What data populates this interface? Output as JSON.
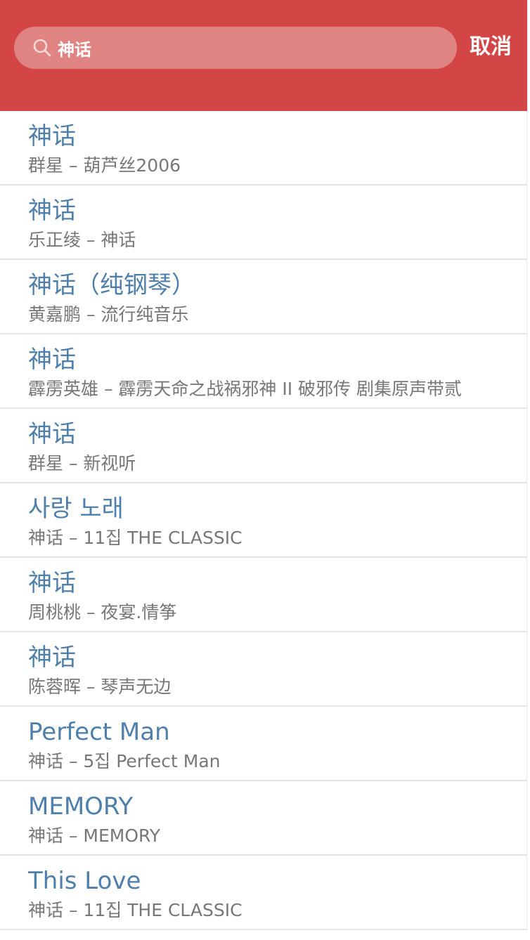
{
  "header": {
    "background": "#d44545",
    "search": {
      "value": "神话",
      "icon": "search-icon"
    },
    "cancel_label": "取消"
  },
  "colors": {
    "title": "#4f7fab",
    "subtitle": "#777777"
  },
  "results": [
    {
      "title": "神话",
      "subtitle": "群星 – 葫芦丝2006"
    },
    {
      "title": "神话",
      "subtitle": "乐正绫 – 神话"
    },
    {
      "title": "神话（纯钢琴）",
      "subtitle": "黄嘉鹏 – 流行纯音乐"
    },
    {
      "title": "神话",
      "subtitle": "霹雳英雄 – 霹雳天命之战祸邪神 II 破邪传 剧集原声带贰"
    },
    {
      "title": "神话",
      "subtitle": "群星 – 新视听"
    },
    {
      "title": "사랑 노래",
      "subtitle": "神话 – 11집 THE CLASSIC"
    },
    {
      "title": "神话",
      "subtitle": "周桃桃 – 夜宴.情筝"
    },
    {
      "title": "神话",
      "subtitle": "陈蓉晖 – 琴声无边"
    },
    {
      "title": "Perfect Man",
      "subtitle": "神话 – 5집 Perfect Man"
    },
    {
      "title": "MEMORY",
      "subtitle": "神话 – MEMORY"
    },
    {
      "title": "This Love",
      "subtitle": "神话 – 11집 THE CLASSIC"
    }
  ]
}
